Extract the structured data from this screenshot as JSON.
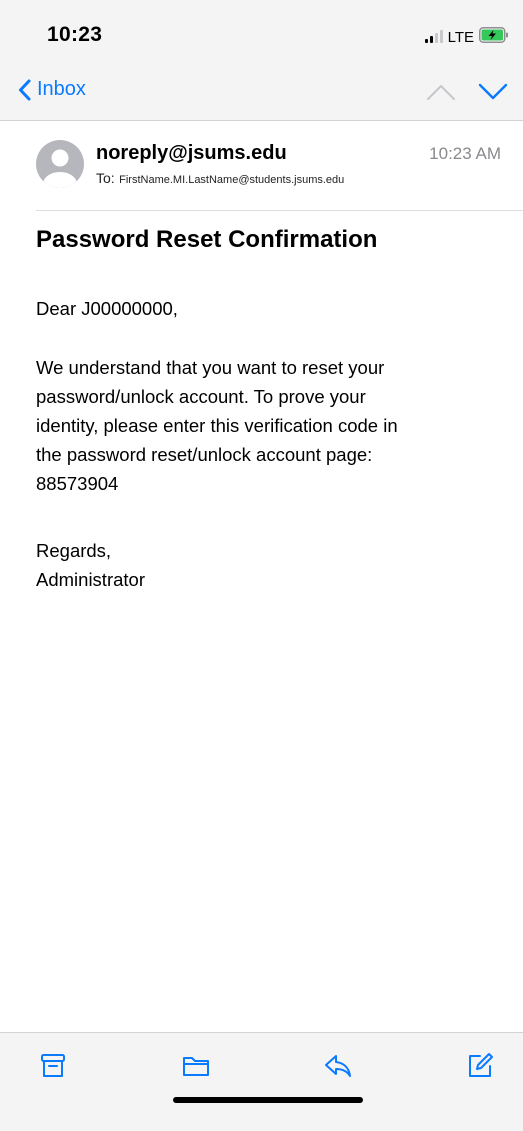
{
  "status_bar": {
    "time": "10:23",
    "network": "LTE"
  },
  "nav": {
    "back_label": "Inbox"
  },
  "email": {
    "sender": "noreply@jsums.edu",
    "time": "10:23 AM",
    "to_label": "To:",
    "to_address": "FirstName.MI.LastName@students.jsums.edu",
    "subject": "Password Reset Confirmation",
    "body": {
      "greeting": "Dear J00000000,",
      "paragraph_lines": [
        "We understand that you want to reset your",
        "password/unlock account. To prove your",
        "identity, please enter this verification code in",
        "the password reset/unlock account page:",
        "88573904"
      ],
      "closing": "Regards,",
      "signature": "Administrator"
    }
  },
  "colors": {
    "accent": "#0a7aff",
    "bar_background": "#f4f4f4",
    "battery_green": "#34c759",
    "muted_text": "#8a8a8e"
  },
  "icons": {
    "back": "chevron-left-icon",
    "previous_message": "chevron-up-icon",
    "next_message": "chevron-down-icon",
    "archive": "archive-icon",
    "move": "folder-icon",
    "reply": "reply-icon",
    "compose": "compose-icon"
  }
}
